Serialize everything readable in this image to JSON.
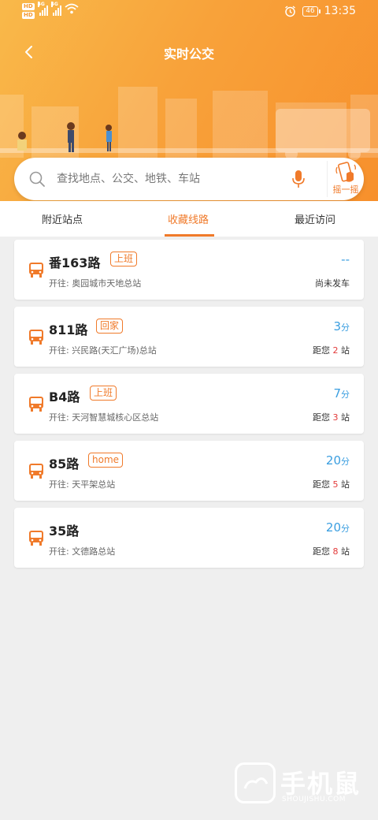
{
  "status_bar": {
    "hd_badges": [
      "HD",
      "HD"
    ],
    "network": [
      "4G",
      "4G"
    ],
    "battery": "46",
    "time": "13:35"
  },
  "nav": {
    "title": "实时公交"
  },
  "search": {
    "placeholder": "查找地点、公交、地铁、车站",
    "shake_label": "摇一摇"
  },
  "tabs": [
    {
      "label": "附近站点",
      "active": false
    },
    {
      "label": "收藏线路",
      "active": true
    },
    {
      "label": "最近访问",
      "active": false
    }
  ],
  "routes": [
    {
      "name": "番163路",
      "tag": "上班",
      "dest_prefix": "开往:",
      "dest": "奥园城市天地总站",
      "eta": "--",
      "eta_unit": "",
      "dist": "尚未发车",
      "dist_pre": "",
      "dist_num": "",
      "dist_post": ""
    },
    {
      "name": "811路",
      "tag": "回家",
      "dest_prefix": "开往:",
      "dest": "兴民路(天汇广场)总站",
      "eta": "3",
      "eta_unit": "分",
      "dist": "",
      "dist_pre": "距您 ",
      "dist_num": "2",
      "dist_post": " 站"
    },
    {
      "name": "B4路",
      "tag": "上班",
      "dest_prefix": "开往:",
      "dest": "天河智慧城核心区总站",
      "eta": "7",
      "eta_unit": "分",
      "dist": "",
      "dist_pre": "距您 ",
      "dist_num": "3",
      "dist_post": " 站"
    },
    {
      "name": "85路",
      "tag": "home",
      "dest_prefix": "开往:",
      "dest": "天平架总站",
      "eta": "20",
      "eta_unit": "分",
      "dist": "",
      "dist_pre": "距您 ",
      "dist_num": "5",
      "dist_post": " 站"
    },
    {
      "name": "35路",
      "tag": "",
      "dest_prefix": "开往:",
      "dest": "文德路总站",
      "eta": "20",
      "eta_unit": "分",
      "dist": "",
      "dist_pre": "距您 ",
      "dist_num": "8",
      "dist_post": " 站"
    }
  ],
  "watermark": {
    "text": "手机鼠",
    "sub": "SHOUJISHU.COM"
  },
  "colors": {
    "accent": "#f07a2a",
    "eta_blue": "#3a9ee0",
    "stop_red": "#e23a3a"
  }
}
